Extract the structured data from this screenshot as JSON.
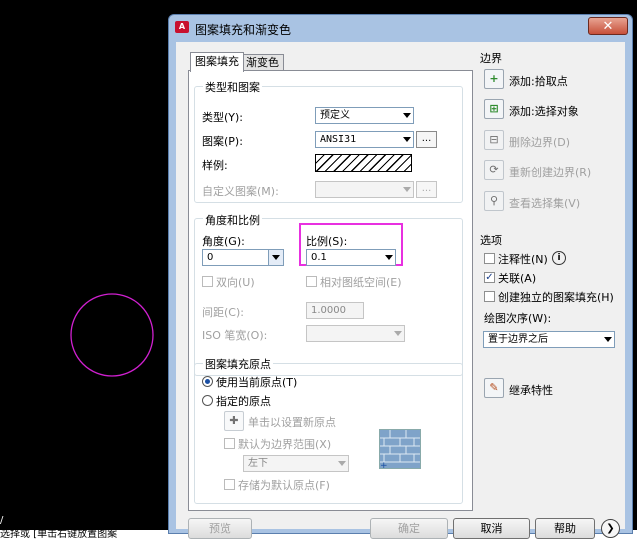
{
  "dialog": {
    "title": "图案填充和渐变色",
    "tabs": [
      "图案填充",
      "渐变色"
    ]
  },
  "type_pattern": {
    "group_label": "类型和图案",
    "type_label": "类型(Y):",
    "type_value": "预定义",
    "pattern_label": "图案(P):",
    "pattern_value": "ANSI31",
    "swatch_label": "样例:",
    "custom_label": "自定义图案(M):"
  },
  "angle_scale": {
    "group_label": "角度和比例",
    "angle_label": "角度(G):",
    "angle_value": "0",
    "scale_label": "比例(S):",
    "scale_value": "0.1",
    "double_label": "双向(U)",
    "relative_label": "相对图纸空间(E)",
    "spacing_label": "间距(C):",
    "spacing_value": "1.0000",
    "iso_label": "ISO 笔宽(O):"
  },
  "origin": {
    "group_label": "图案填充原点",
    "use_current": "使用当前原点(T)",
    "specified": "指定的原点",
    "click_set": "单击以设置新原点",
    "default_extent": "默认为边界范围(X)",
    "position_value": "左下",
    "store_default": "存储为默认原点(F)"
  },
  "boundaries": {
    "title": "边界",
    "add_pick": "添加:拾取点",
    "add_select": "添加:选择对象",
    "remove": "删除边界(D)",
    "recreate": "重新创建边界(R)",
    "view": "查看选择集(V)"
  },
  "options": {
    "title": "选项",
    "annotative": "注释性(N)",
    "associative": "关联(A)",
    "independent": "创建独立的图案填充(H)",
    "draw_order_label": "绘图次序(W):",
    "draw_order_value": "置于边界之后",
    "inherit": "继承特性"
  },
  "footer": {
    "preview": "预览",
    "ok": "确定",
    "cancel": "取消",
    "help": "帮助"
  },
  "cad": {
    "command_text": "选择或 [单击右键放置图案"
  },
  "colors": {
    "highlight": "#e830e0",
    "circle": "#d020d0",
    "title_bar": "#a9c3e3"
  }
}
